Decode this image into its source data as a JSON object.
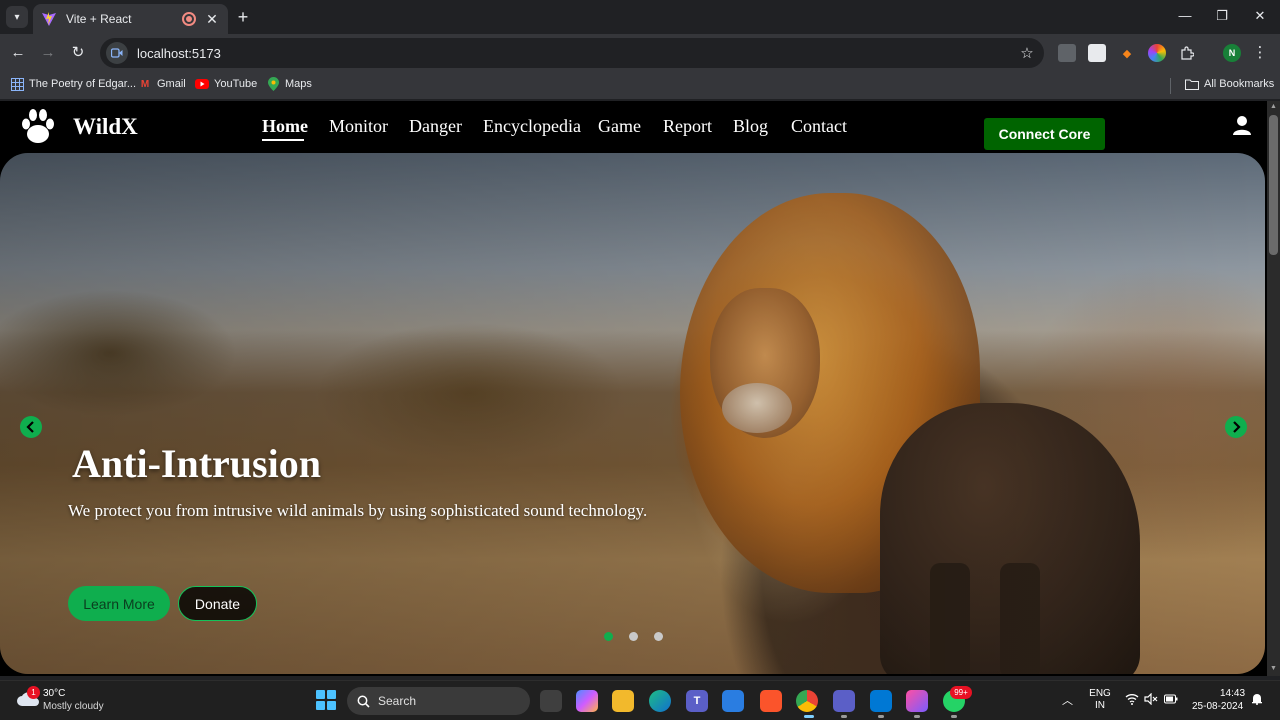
{
  "browser": {
    "tab": {
      "title": "Vite + React",
      "close": "✕"
    },
    "new_tab": "+",
    "window": {
      "minimize": "—",
      "maximize": "❐",
      "close": "✕"
    },
    "toolbar": {
      "back": "←",
      "forward": "→",
      "reload": "↻",
      "url": "localhost:5173",
      "star": "☆",
      "menu": "⋮",
      "profile_initial": "N"
    },
    "bookmarks": [
      {
        "label": "The Poetry of Edgar...",
        "icon": "grid-icon"
      },
      {
        "label": "Gmail",
        "icon": "gmail-icon"
      },
      {
        "label": "YouTube",
        "icon": "youtube-icon"
      },
      {
        "label": "Maps",
        "icon": "maps-icon"
      }
    ],
    "all_bookmarks": "All Bookmarks"
  },
  "site": {
    "logo": "WildX",
    "nav": [
      "Home",
      "Monitor",
      "Danger",
      "Encyclopedia",
      "Game",
      "Report",
      "Blog",
      "Contact"
    ],
    "active_nav": "Home",
    "connect_button": "Connect Core",
    "slide": {
      "title": "Anti-Intrusion",
      "text": "We protect you from intrusive wild animals by using sophisticated sound technology.",
      "learn_more": "Learn More",
      "donate": "Donate",
      "slide_count": 3,
      "active_slide": 1
    },
    "colors": {
      "accent_green": "#0fae4e",
      "connect_green": "#006400"
    }
  },
  "taskbar": {
    "weather": {
      "temp": "30°C",
      "desc": "Mostly cloudy",
      "badge": "1"
    },
    "search": "Search",
    "whatsapp_badge": "99+",
    "lang": {
      "line1": "ENG",
      "line2": "IN"
    },
    "time": "14:43",
    "date": "25-08-2024"
  }
}
